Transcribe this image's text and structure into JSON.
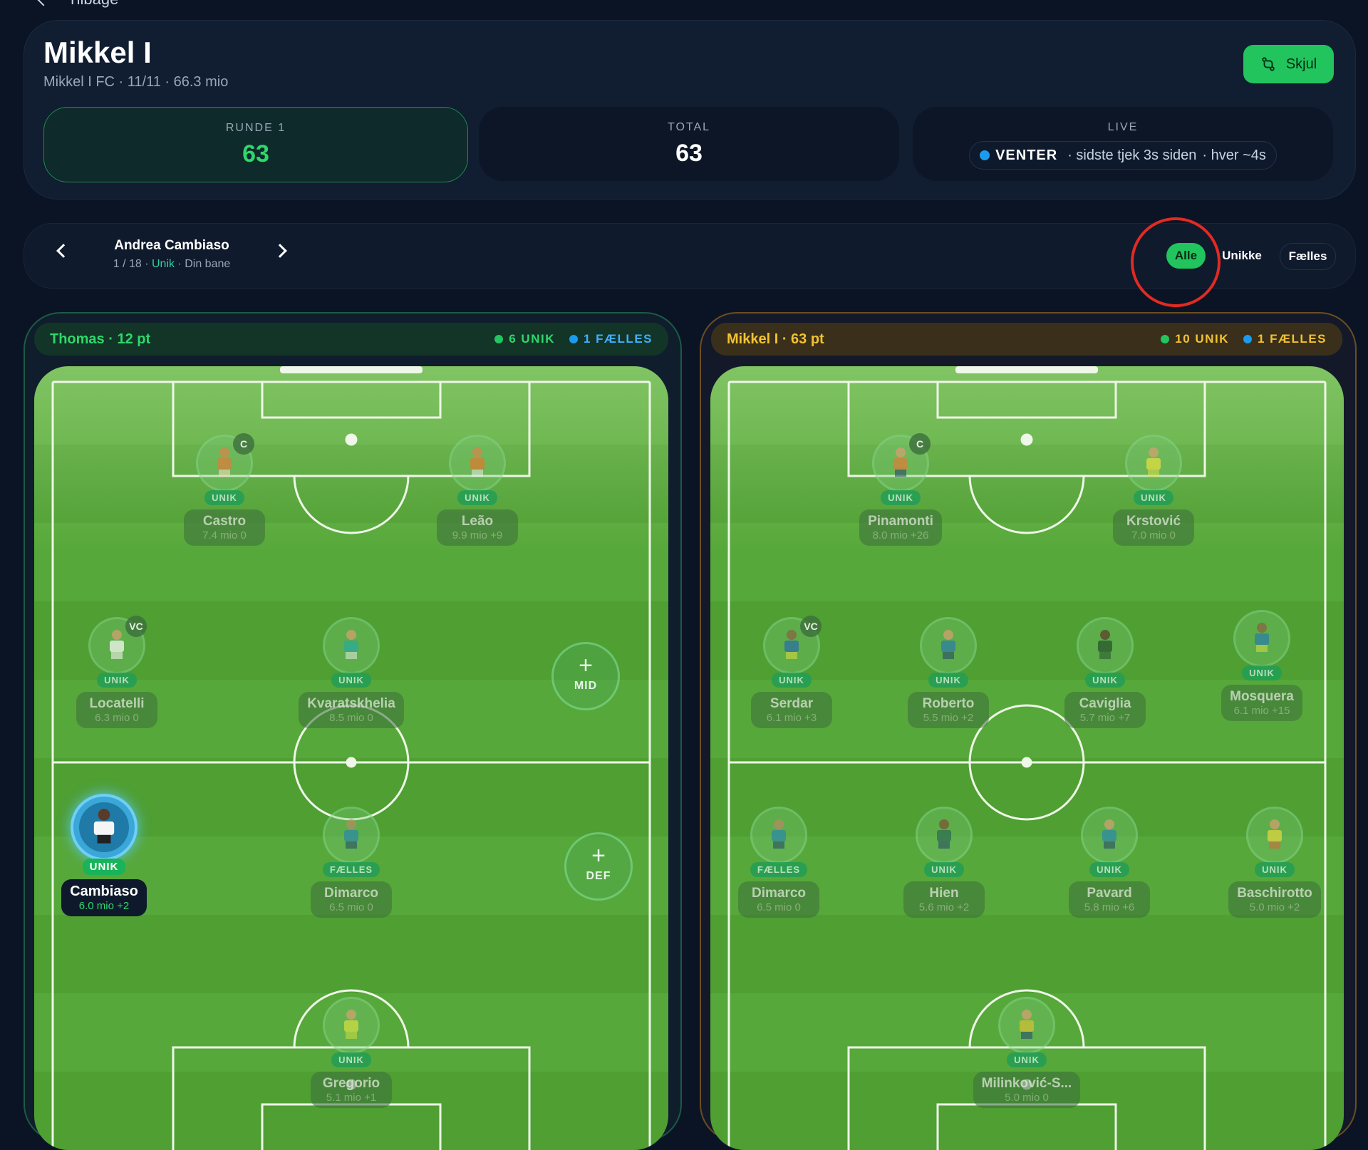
{
  "nav": {
    "back_label": "Tilbage"
  },
  "team": {
    "name": "Mikkel I",
    "subtitle": "Mikkel I FC · 11/11 · 66.3 mio",
    "hide_label": "Skjul"
  },
  "stats": {
    "round": {
      "label": "RUNDE 1",
      "value": "63"
    },
    "total": {
      "label": "TOTAL",
      "value": "63"
    },
    "live": {
      "label": "LIVE",
      "status": "VENTER",
      "checked": "· sidste tjek 3s siden",
      "interval": "· hver ~4s"
    }
  },
  "player_nav": {
    "name": "Andrea Cambiaso",
    "index": "1 / 18 ·",
    "tag": "Unik",
    "suffix": "· Din bane"
  },
  "filters": {
    "all": "Alle",
    "unique": "Unikke",
    "shared": "Fælles"
  },
  "left": {
    "title": "Thomas · 12 pt",
    "unique": "6 UNIK",
    "shared": "1 FÆLLES",
    "players": [
      {
        "name": "Castro",
        "meta": "7.4 mio  0",
        "role": "UNIK",
        "cap": "C"
      },
      {
        "name": "Leão",
        "meta": "9.9 mio  +9",
        "role": "UNIK"
      },
      {
        "name": "Locatelli",
        "meta": "6.3 mio  0",
        "role": "UNIK",
        "cap": "VC"
      },
      {
        "name": "Kvaratskhelia",
        "meta": "8.5 mio  0",
        "role": "UNIK"
      },
      {
        "name": "Cambiaso",
        "meta": "6.0 mio  +2",
        "role": "UNIK"
      },
      {
        "name": "Dimarco",
        "meta": "6.5 mio  0",
        "role": "FÆLLES"
      },
      {
        "name": "Gregorio",
        "meta": "5.1 mio  +1",
        "role": "UNIK"
      }
    ],
    "adds": [
      "MID",
      "DEF"
    ]
  },
  "right": {
    "title": "Mikkel I · 63 pt",
    "unique": "10 UNIK",
    "shared": "1 FÆLLES",
    "players": [
      {
        "name": "Pinamonti",
        "meta": "8.0 mio  +26",
        "role": "UNIK",
        "cap": "C"
      },
      {
        "name": "Krstović",
        "meta": "7.0 mio  0",
        "role": "UNIK"
      },
      {
        "name": "Serdar",
        "meta": "6.1 mio  +3",
        "role": "UNIK",
        "cap": "VC"
      },
      {
        "name": "Roberto",
        "meta": "5.5 mio  +2",
        "role": "UNIK"
      },
      {
        "name": "Caviglia",
        "meta": "5.7 mio  +7",
        "role": "UNIK"
      },
      {
        "name": "Mosquera",
        "meta": "6.1 mio  +15",
        "role": "UNIK"
      },
      {
        "name": "Dimarco",
        "meta": "6.5 mio  0",
        "role": "FÆLLES"
      },
      {
        "name": "Hien",
        "meta": "5.6 mio  +2",
        "role": "UNIK"
      },
      {
        "name": "Pavard",
        "meta": "5.8 mio  +6",
        "role": "UNIK"
      },
      {
        "name": "Baschirotto",
        "meta": "5.0 mio  +2",
        "role": "UNIK"
      },
      {
        "name": "Milinković-S...",
        "meta": "5.0 mio  0",
        "role": "UNIK"
      }
    ]
  },
  "colors": {
    "accent": "#21c45d",
    "unique": "#22c55e",
    "shared": "#1a9bf0",
    "highlight": "#e22a22"
  }
}
